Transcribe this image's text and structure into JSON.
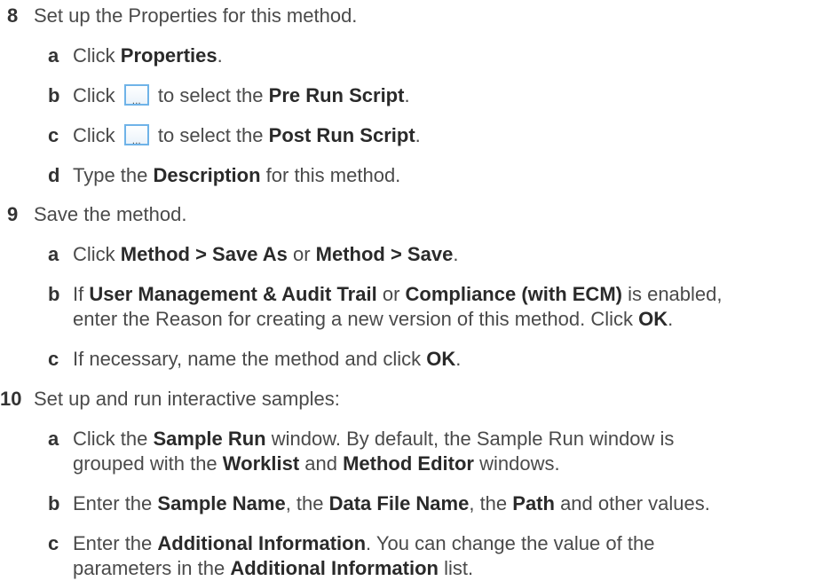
{
  "steps": [
    {
      "num": "8",
      "text": "Set up the Properties for this method."
    },
    {
      "num": "9",
      "text": "Save the method."
    },
    {
      "num": "10",
      "text": "Set up and run interactive samples:"
    }
  ],
  "s8": {
    "a": {
      "letter": "a",
      "pre": "Click ",
      "b1": "Properties",
      "post": "."
    },
    "b": {
      "letter": "b",
      "pre": "Click ",
      "btn": "...",
      "mid": " to select the ",
      "b1": "Pre Run Script",
      "post": "."
    },
    "c": {
      "letter": "c",
      "pre": "Click ",
      "btn": "...",
      "mid": " to select the ",
      "b1": "Post Run Script",
      "post": "."
    },
    "d": {
      "letter": "d",
      "pre": "Type the ",
      "b1": "Description",
      "post": " for this method."
    }
  },
  "s9": {
    "a": {
      "letter": "a",
      "pre": "Click ",
      "b1": "Method > Save As",
      "mid": " or ",
      "b2": "Method > Save",
      "post": "."
    },
    "b": {
      "letter": "b",
      "pre": "If ",
      "b1": "User Management & Audit Trail",
      "mid": " or ",
      "b2": "Compliance (with ECM)",
      "post": " is enabled,",
      "l2pre": "enter the Reason for creating a new version of this method. Click ",
      "l2b": "OK",
      "l2post": "."
    },
    "c": {
      "letter": "c",
      "pre": "If necessary, name the method and click ",
      "b1": "OK",
      "post": "."
    }
  },
  "s10": {
    "a": {
      "letter": "a",
      "pre": "Click the ",
      "b1": "Sample Run",
      "post": " window. By default, the Sample Run window is",
      "l2pre": "grouped with the ",
      "l2b1": "Worklist",
      "l2mid": " and ",
      "l2b2": "Method Editor",
      "l2post": " windows."
    },
    "b": {
      "letter": "b",
      "pre": "Enter the ",
      "b1": "Sample Name",
      "m1": ", the ",
      "b2": "Data File Name",
      "m2": ", the ",
      "b3": "Path",
      "post": " and other values."
    },
    "c": {
      "letter": "c",
      "pre": "Enter the ",
      "b1": "Additional Information",
      "post": ". You can change the value of the",
      "l2pre": "parameters in the ",
      "l2b": "Additional Information",
      "l2post": " list."
    }
  }
}
